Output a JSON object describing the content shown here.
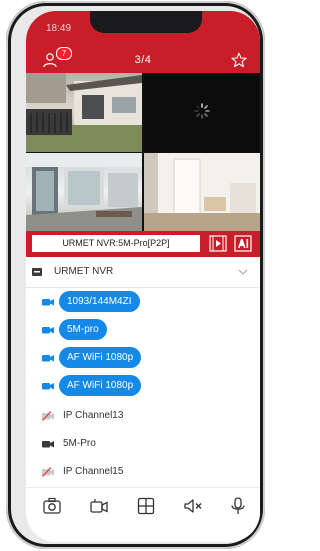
{
  "status": {
    "time": "18:49"
  },
  "header": {
    "notifications_count": "7",
    "page_counter": "3/4"
  },
  "device_bar": {
    "device_name": "URMET NVR:5M-Pro[P2P]"
  },
  "device_group": {
    "label": "URMET NVR"
  },
  "channels": [
    {
      "label": "1093/144M4ZI",
      "state": "selected",
      "icon": "camera-icon"
    },
    {
      "label": "5M-pro",
      "state": "selected",
      "icon": "camera-icon"
    },
    {
      "label": "AF WiFi 1080p",
      "state": "selected",
      "icon": "camera-icon"
    },
    {
      "label": "AF WiFi 1080p",
      "state": "selected",
      "icon": "camera-icon"
    },
    {
      "label": "IP Channel13",
      "state": "offline",
      "icon": "camera-offline-icon"
    },
    {
      "label": "5M-Pro",
      "state": "online",
      "icon": "camera-icon"
    },
    {
      "label": "IP Channel15",
      "state": "offline",
      "icon": "camera-offline-icon"
    }
  ],
  "toolbar": {
    "icons": [
      "snapshot-icon",
      "record-icon",
      "layout-grid-icon",
      "mute-icon",
      "microphone-icon"
    ]
  },
  "colors": {
    "accent": "#c81e2a",
    "selected_pill": "#1589e8",
    "offline": "#e04848"
  }
}
